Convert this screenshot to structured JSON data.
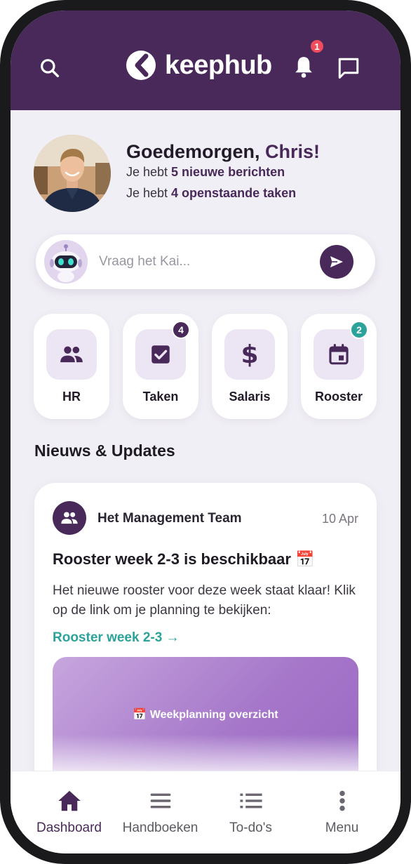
{
  "app": {
    "brand": "keephub"
  },
  "header": {
    "notification_count": "1"
  },
  "greeting": {
    "title_prefix": "Goedemorgen, ",
    "name": "Chris!",
    "line1_prefix": "Je hebt ",
    "line1_bold": "5 nieuwe berichten",
    "line2_prefix": "Je hebt ",
    "line2_bold": "4 openstaande taken"
  },
  "assistant": {
    "placeholder": "Vraag het Kai..."
  },
  "tiles": [
    {
      "label": "HR",
      "icon": "people-icon",
      "badge": ""
    },
    {
      "label": "Taken",
      "icon": "checkbox-icon",
      "badge": "4",
      "badge_color": "#48295a"
    },
    {
      "label": "Salaris",
      "icon": "dollar-icon",
      "badge": ""
    },
    {
      "label": "Rooster",
      "icon": "calendar-icon",
      "badge": "2",
      "badge_color": "#2ba39a"
    }
  ],
  "news": {
    "section_title": "Nieuws & Updates",
    "post": {
      "author": "Het Management Team",
      "date": "10 Apr",
      "title": "Rooster week 2-3 is beschikbaar 📅",
      "body": "Het nieuwe rooster voor deze week staat klaar! Klik op de link om je planning te bekijken:",
      "link": "Rooster week 2-3 →",
      "preview_caption": "📅 Weekplanning overzicht"
    }
  },
  "bottom_nav": [
    {
      "label": "Dashboard",
      "icon": "home-icon",
      "active": true
    },
    {
      "label": "Handboeken",
      "icon": "hamburger-icon",
      "active": false
    },
    {
      "label": "To-do's",
      "icon": "list-icon",
      "active": false
    },
    {
      "label": "Menu",
      "icon": "more-vertical-icon",
      "active": false
    }
  ],
  "colors": {
    "brand": "#48295a",
    "accent": "#2ba39a",
    "alert": "#ef4c5c",
    "background": "#f1eff6"
  }
}
